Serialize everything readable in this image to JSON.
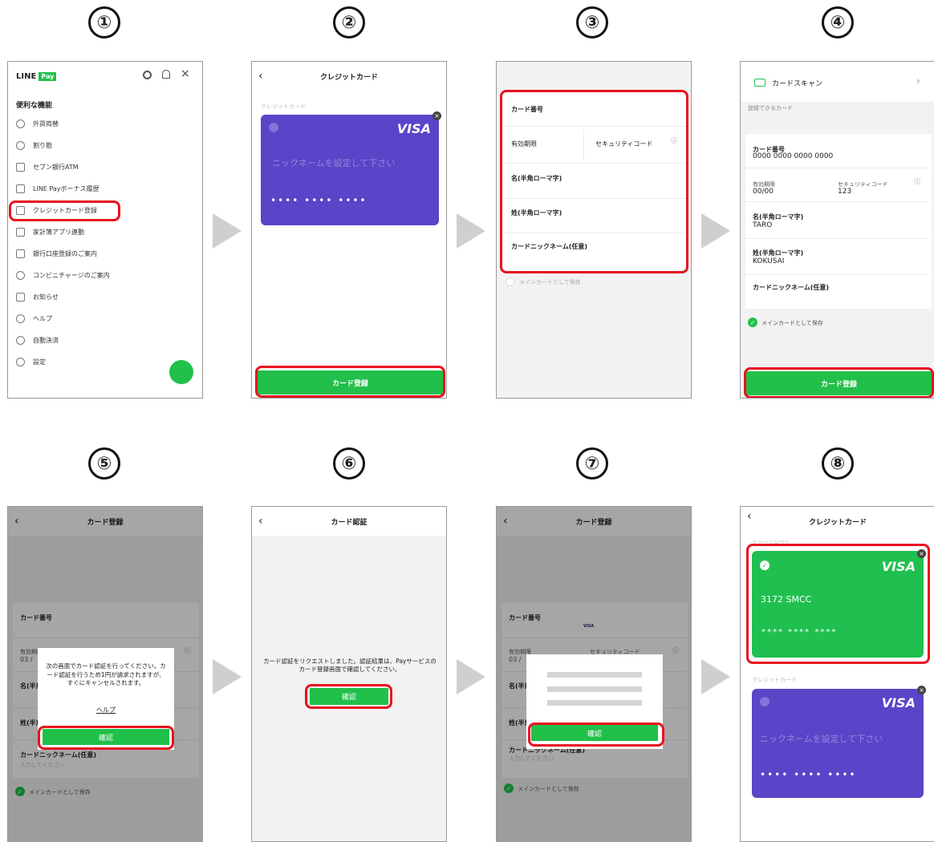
{
  "steps": [
    "①",
    "②",
    "③",
    "④",
    "⑤",
    "⑥",
    "⑦",
    "⑧"
  ],
  "screen1": {
    "logo_line": "LINE",
    "logo_pay": "Pay",
    "section": "便利な機能",
    "menu": [
      "外貨両替",
      "割り勘",
      "セブン銀行ATM",
      "LINE Payボーナス履歴",
      "クレジットカード登録",
      "家計簿アプリ連動",
      "銀行口座登録のご案内",
      "コンビニチャージのご案内",
      "お知らせ",
      "ヘルプ",
      "自動決済",
      "設定"
    ]
  },
  "screen2": {
    "title": "クレジットカード",
    "section": "クレジットカード",
    "card_brand": "VISA",
    "card_placeholder": "ニックネームを設定して下さい",
    "card_dots": "••••  ••••  ••••",
    "button": "カード登録"
  },
  "screen3": {
    "card_number": "カード番号",
    "expiry": "有効期限",
    "security": "セキュリティコード",
    "first_name": "名(半角ローマ字)",
    "last_name": "姓(半角ローマ字)",
    "nickname": "カードニックネーム(任意)",
    "main_card": "メインカードとして保存"
  },
  "screen4": {
    "scan": "カードスキャン",
    "registerable": "登録できるカード",
    "card_number_label": "カード番号",
    "card_number_value": "0000 0000 0000 0000",
    "expiry_label": "有効期限",
    "expiry_value": "00/00",
    "security_label": "セキュリティコード",
    "security_value": "123",
    "first_label": "名(半角ローマ字)",
    "first_value": "TARO",
    "last_label": "姓(半角ローマ字)",
    "last_value": "KOKUSAI",
    "nickname_label": "カードニックネーム(任意)",
    "main_card": "メインカードとして保存",
    "button": "カード登録"
  },
  "screen5": {
    "title": "カード登録",
    "card_number": "カード番号",
    "expiry": "有効期限",
    "expiry_partial": "03 /",
    "first_partial": "名(半角",
    "last_partial": "姓(半角",
    "nickname": "カードニックネーム(任意)",
    "nickname_placeholder": "入力してください",
    "main_card": "メインカードとして保存",
    "dialog_text": "次の画面でカード認証を行ってください。カード認証を行うため1円が請求されますが、すぐにキャンセルされます。",
    "help": "ヘルプ",
    "confirm": "確認"
  },
  "screen6": {
    "title": "カード認証",
    "message": "カード認証をリクエストしました。認証結果は、Payサービスのカード登録画面で確認してください。",
    "confirm": "確認"
  },
  "screen7": {
    "title": "カード登録",
    "card_number": "カード番号",
    "visa": "VISA",
    "expiry": "有効期限",
    "expiry_partial": "03 /",
    "security": "セキュリティコード",
    "first_partial": "名(半角",
    "last_partial": "姓(半角",
    "nickname": "カードニックネーム(任意)",
    "nickname_placeholder": "入力してください",
    "main_card": "メインカードとして保存",
    "confirm": "確認"
  },
  "screen8": {
    "title": "クレジットカード",
    "charge_section": "チャージ&ペイ",
    "card1_number": "3172 SMCC",
    "card1_dots": "****  ****  ****",
    "brand": "VISA",
    "credit_section": "クレジットカード",
    "card2_placeholder": "ニックネームを設定して下さい",
    "card2_dots": "••••  ••••  ••••"
  },
  "colors": {
    "accent_green": "#21c04a",
    "highlight_red": "#e8121f",
    "card_purple": "#5a44c8"
  }
}
